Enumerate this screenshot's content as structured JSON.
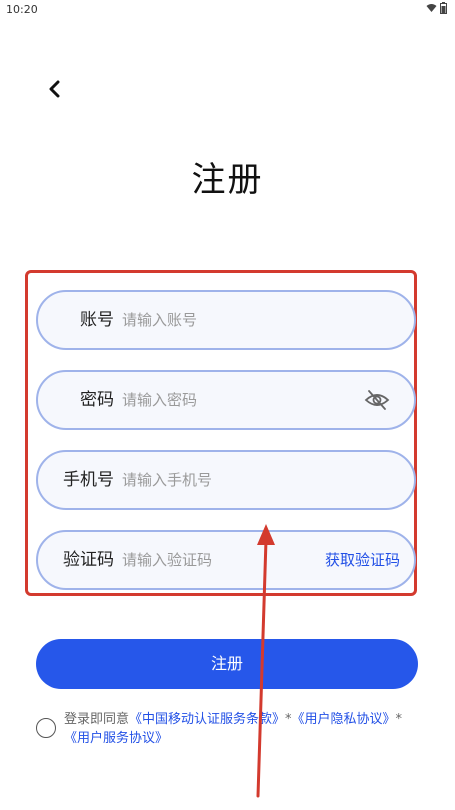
{
  "status_bar": {
    "time": "10:20"
  },
  "header": {
    "title": "注册"
  },
  "form": {
    "account": {
      "label": "账号",
      "placeholder": "请输入账号",
      "value": ""
    },
    "password": {
      "label": "密码",
      "placeholder": "请输入密码",
      "value": ""
    },
    "phone": {
      "label": "手机号",
      "placeholder": "请输入手机号",
      "value": ""
    },
    "code": {
      "label": "验证码",
      "placeholder": "请输入验证码",
      "value": "",
      "action": "获取验证码"
    }
  },
  "register_button": {
    "label": "注册"
  },
  "agreement": {
    "prefix": "登录即同意",
    "link1": "《中国移动认证服务条款》",
    "sep1": "*",
    "link2": "《用户隐私协议》",
    "sep2": "*",
    "link3": "《用户服务协议》"
  },
  "colors": {
    "accent": "#2657ea",
    "annotation": "#d33a2e",
    "field_border": "#9fb3ea"
  }
}
